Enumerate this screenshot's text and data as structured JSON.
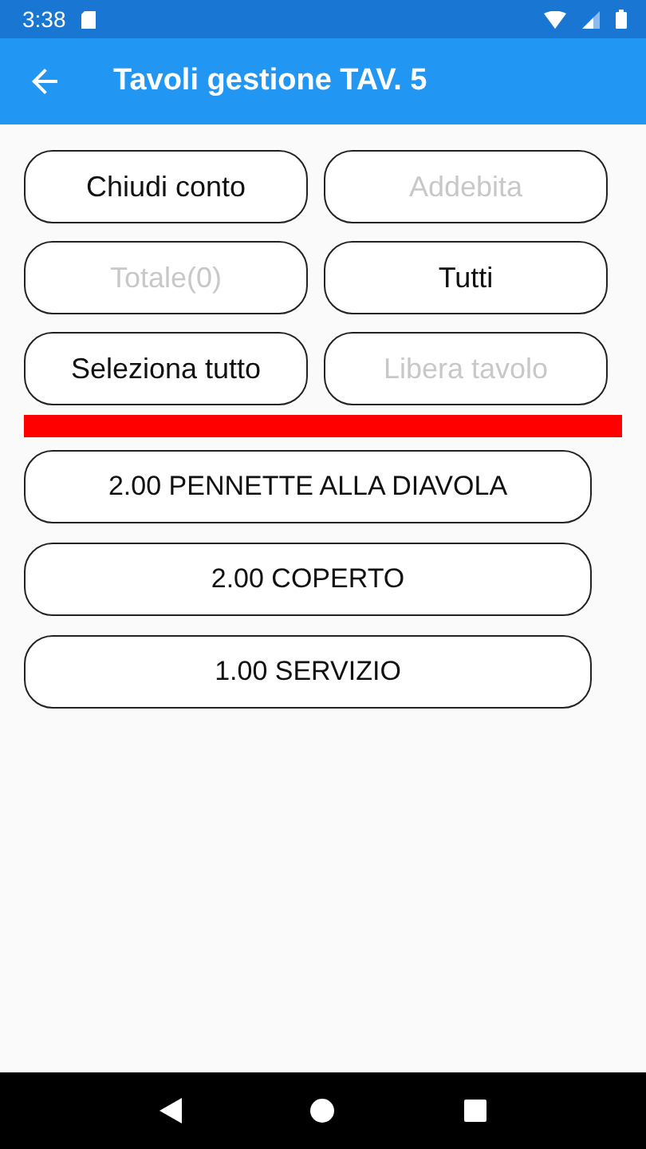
{
  "status_bar": {
    "time": "3:38"
  },
  "app_bar": {
    "title": "Tavoli gestione TAV. 5"
  },
  "actions": [
    {
      "label": "Chiudi conto",
      "disabled": false
    },
    {
      "label": "Addebita",
      "disabled": true
    },
    {
      "label": "Totale(0)",
      "disabled": true
    },
    {
      "label": "Tutti",
      "disabled": false
    },
    {
      "label": "Seleziona tutto",
      "disabled": false
    },
    {
      "label": "Libera tavolo",
      "disabled": true
    }
  ],
  "items": [
    {
      "label": "2.00 PENNETTE ALLA DIAVOLA"
    },
    {
      "label": "2.00 COPERTO"
    },
    {
      "label": "1.00 SERVIZIO"
    }
  ]
}
